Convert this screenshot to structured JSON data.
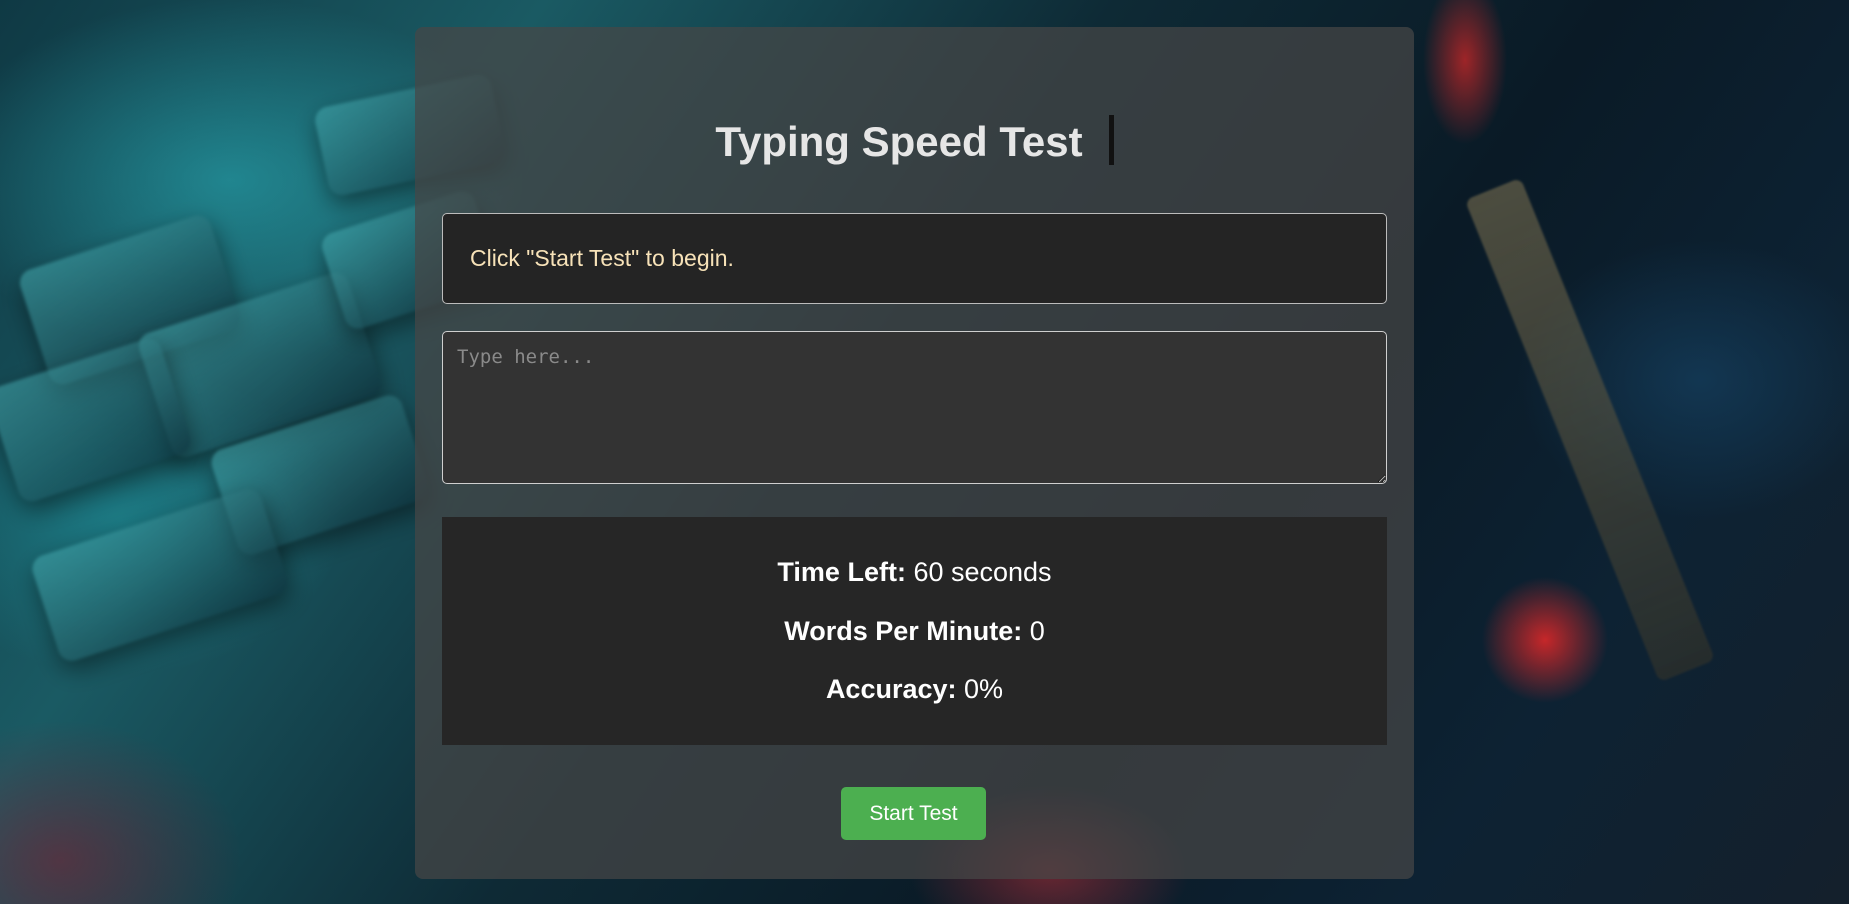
{
  "app": {
    "title": "Typing Speed Test"
  },
  "prompt": {
    "text": "Click \"Start Test\" to begin."
  },
  "typing_area": {
    "placeholder": "Type here...",
    "value": ""
  },
  "stats": {
    "time_left_label": "Time Left:",
    "time_left_value": "60 seconds",
    "wpm_label": "Words Per Minute:",
    "wpm_value": "0",
    "accuracy_label": "Accuracy:",
    "accuracy_value": "0%"
  },
  "actions": {
    "start_label": "Start Test"
  },
  "colors": {
    "accent_button": "#4caf50",
    "prompt_text": "#f7e2b8",
    "panel_bg": "#262626"
  }
}
